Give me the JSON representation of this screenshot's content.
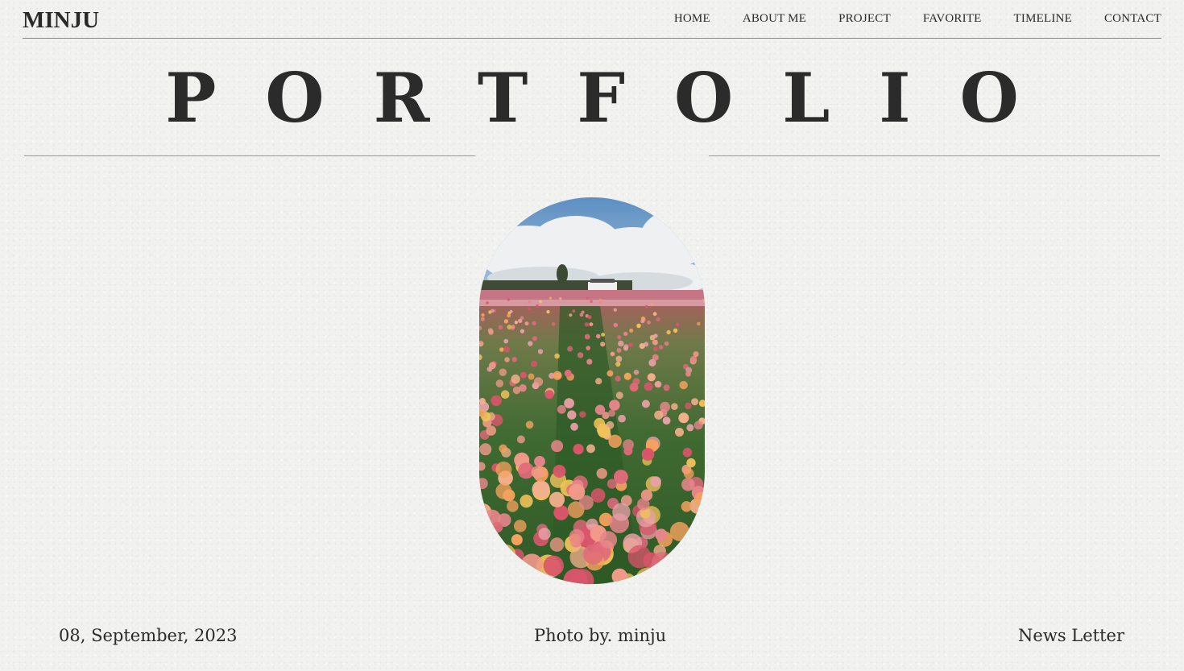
{
  "header": {
    "logo": "MINJU",
    "nav": [
      "HOME",
      "ABOUT ME",
      "PROJECT",
      "FAVORITE",
      "TIMELINE",
      "CONTACT"
    ]
  },
  "hero": {
    "title": "PORTFOLIO"
  },
  "footer": {
    "date": "08, September, 2023",
    "credit": "Photo by. minju",
    "newsletter": "News Letter"
  },
  "colors": {
    "background": "#f1f1ef",
    "text": "#2a2a2a",
    "rule": "#9a9a9a"
  }
}
